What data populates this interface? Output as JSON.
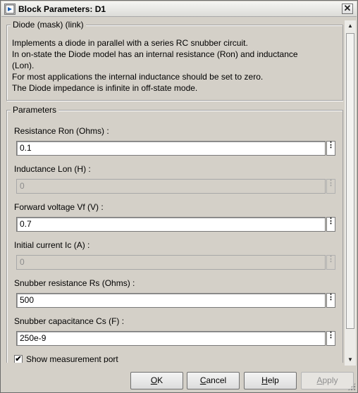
{
  "window": {
    "title": "Block Parameters: D1"
  },
  "description": {
    "legend": "Diode (mask) (link)",
    "lines": [
      "Implements a diode in parallel with a series RC snubber circuit.",
      "In on-state the Diode model has an internal resistance (Ron) and inductance",
      "(Lon).",
      "For most applications the internal inductance should be set to zero.",
      "The Diode impedance is infinite in off-state mode."
    ]
  },
  "parameters": {
    "legend": "Parameters",
    "fields": [
      {
        "label": "Resistance Ron (Ohms) :",
        "value": "0.1",
        "enabled": true
      },
      {
        "label": "Inductance Lon (H) :",
        "value": "0",
        "enabled": false
      },
      {
        "label": "Forward voltage Vf (V) :",
        "value": "0.7",
        "enabled": true
      },
      {
        "label": "Initial current Ic (A) :",
        "value": "0",
        "enabled": false
      },
      {
        "label": "Snubber resistance Rs (Ohms) :",
        "value": "500",
        "enabled": true
      },
      {
        "label": "Snubber capacitance Cs (F) :",
        "value": "250e-9",
        "enabled": true
      }
    ],
    "show_measurement": {
      "label": "Show measurement port",
      "checked": true,
      "mark": "✔"
    }
  },
  "dots_glyph": "⋮",
  "buttons": {
    "ok": {
      "mnemonic": "O",
      "rest": "K"
    },
    "cancel": {
      "mnemonic": "C",
      "rest": "ancel"
    },
    "help": {
      "mnemonic": "H",
      "rest": "elp"
    },
    "apply": {
      "mnemonic": "A",
      "rest": "pply"
    }
  },
  "close_glyph": "✕",
  "scroll": {
    "up_glyph": "▲",
    "down_glyph": "▼"
  }
}
